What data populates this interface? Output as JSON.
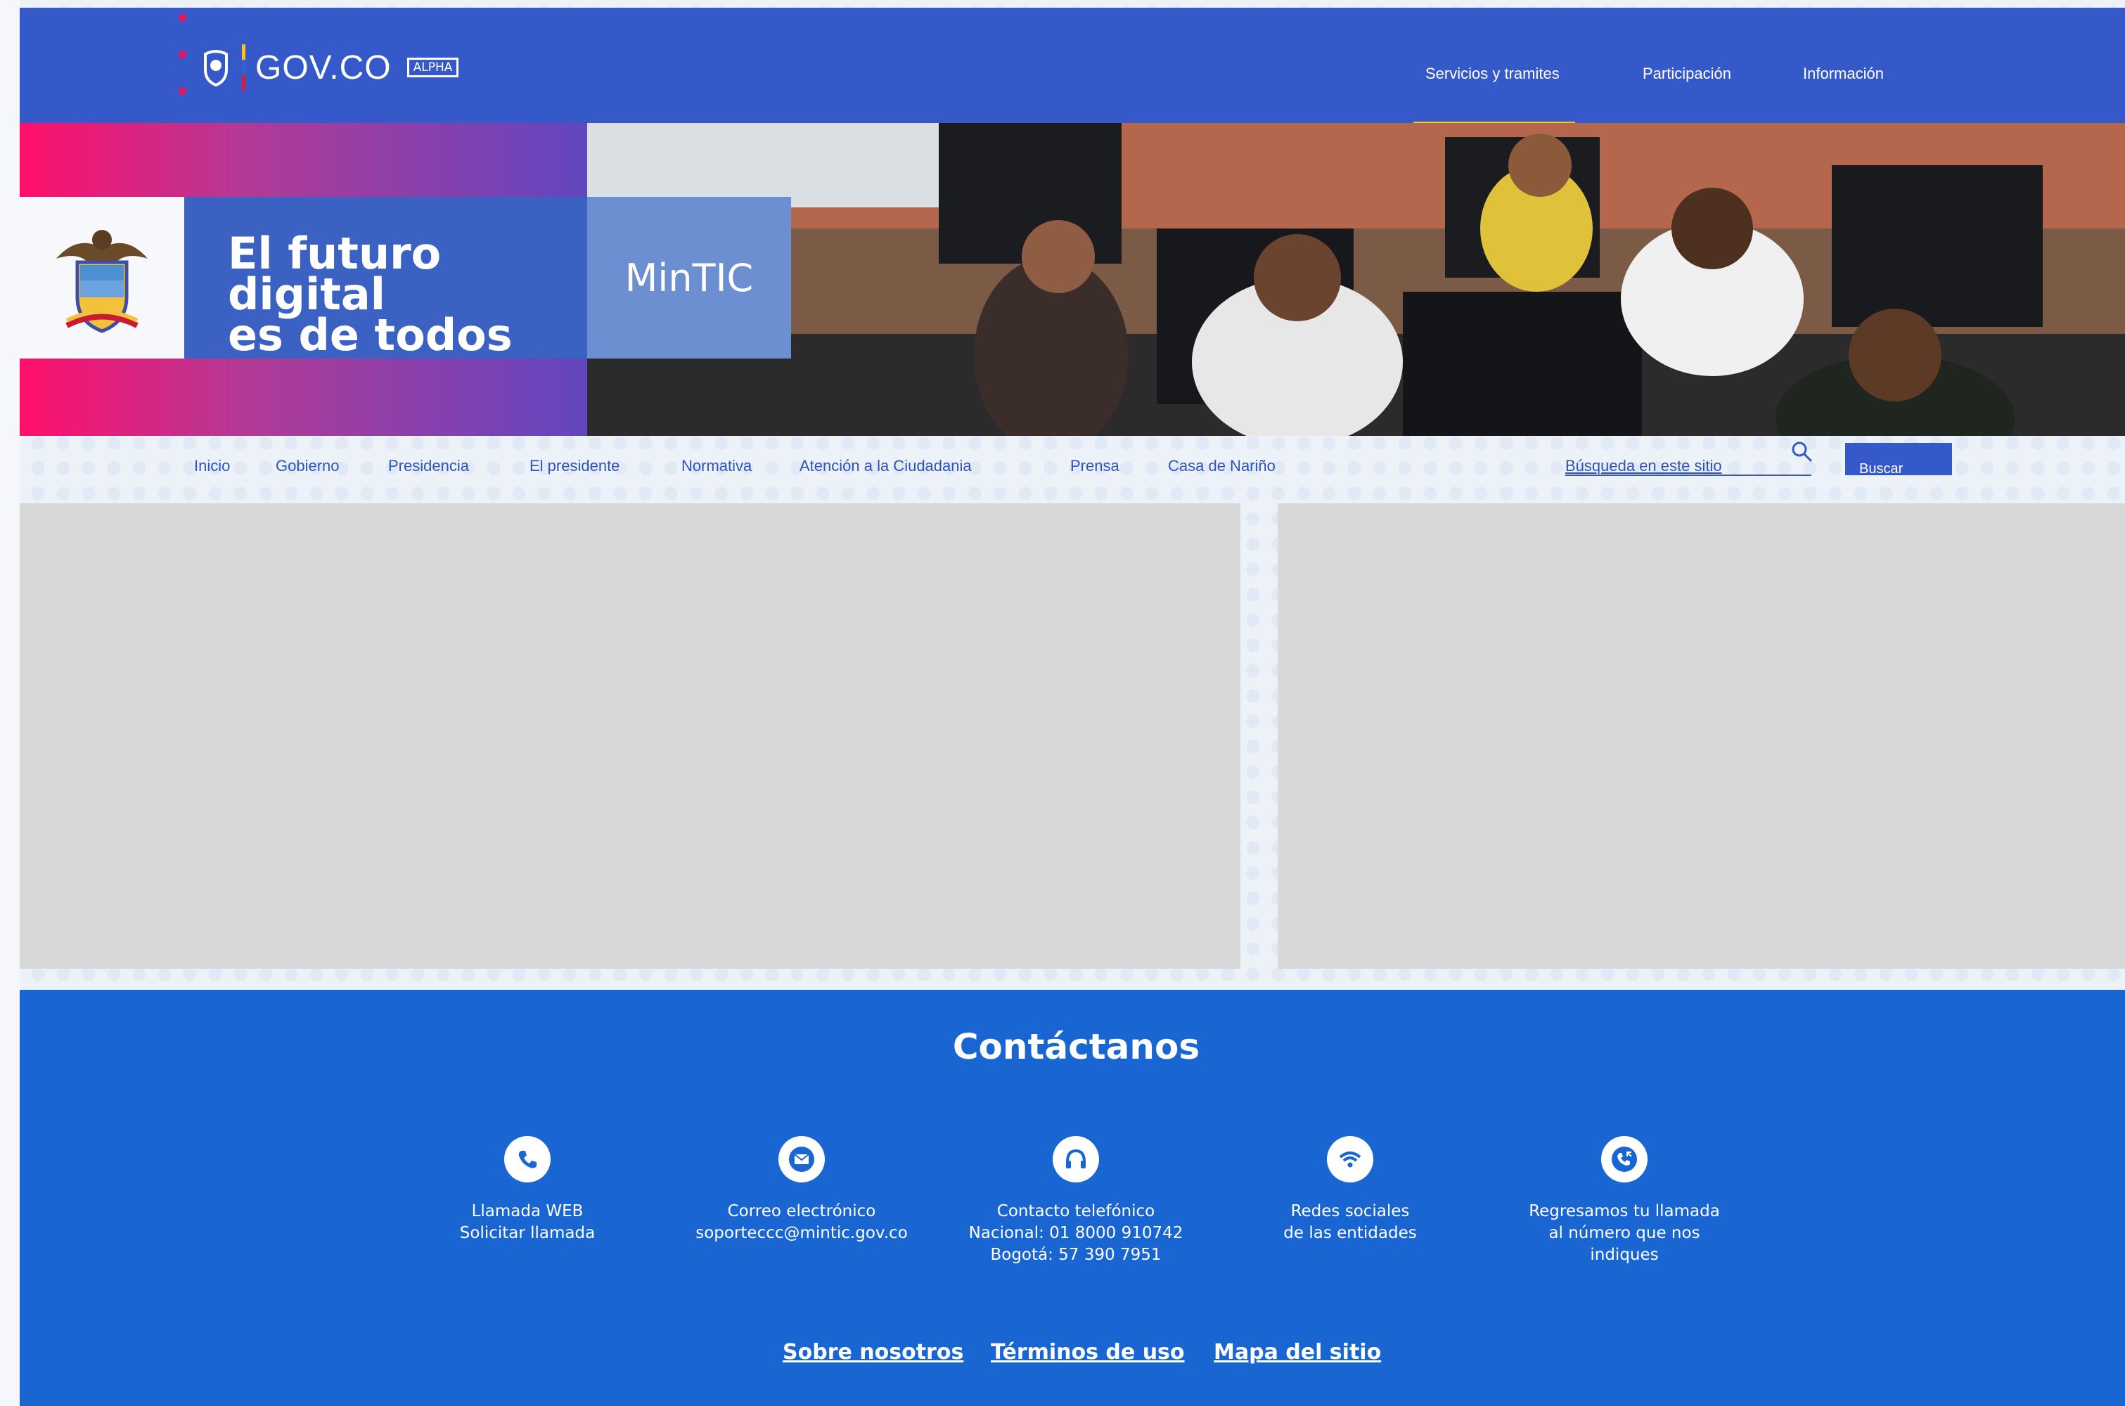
{
  "header": {
    "brand": "GOV.CO",
    "badge": "ALPHA",
    "nav": [
      {
        "label": "Servicios y tramites",
        "active": true
      },
      {
        "label": "Participación",
        "active": false
      },
      {
        "label": "Información",
        "active": false
      }
    ]
  },
  "hero": {
    "slogan_line1": "El futuro digital",
    "slogan_line2": "es de todos",
    "entity": "MinTIC"
  },
  "secondary_nav": {
    "links": [
      "Inicio",
      "Gobierno",
      "Presidencia",
      "El presidente",
      "Normativa",
      "Atención a la Ciudadania",
      "Prensa",
      "Casa de Nariño"
    ],
    "search_label": "Búsqueda en este sitio",
    "search_button": "Buscar"
  },
  "footer": {
    "title": "Contáctanos",
    "contacts": [
      {
        "icon": "phone-icon",
        "lines": [
          "Llamada WEB",
          "Solicitar llamada"
        ]
      },
      {
        "icon": "mail-icon",
        "lines": [
          "Correo electrónico",
          "soporteccc@mintic.gov.co"
        ]
      },
      {
        "icon": "headset-icon",
        "lines": [
          "Contacto telefónico",
          "Nacional: 01 8000 910742",
          "Bogotá: 57 390 7951"
        ]
      },
      {
        "icon": "wifi-icon",
        "lines": [
          "Redes sociales",
          "de las entidades"
        ]
      },
      {
        "icon": "callback-icon",
        "lines": [
          "Regresamos tu llamada",
          "al número que nos",
          "indiques"
        ]
      }
    ],
    "links": [
      "Sobre nosotros",
      "Términos de uso",
      "Mapa del sitio"
    ]
  },
  "colors": {
    "primary": "#3559c8",
    "footer": "#1966d2",
    "accent_yellow": "#f4c80e",
    "accent_pink": "#ff0f6b",
    "link": "#2f54b8"
  }
}
